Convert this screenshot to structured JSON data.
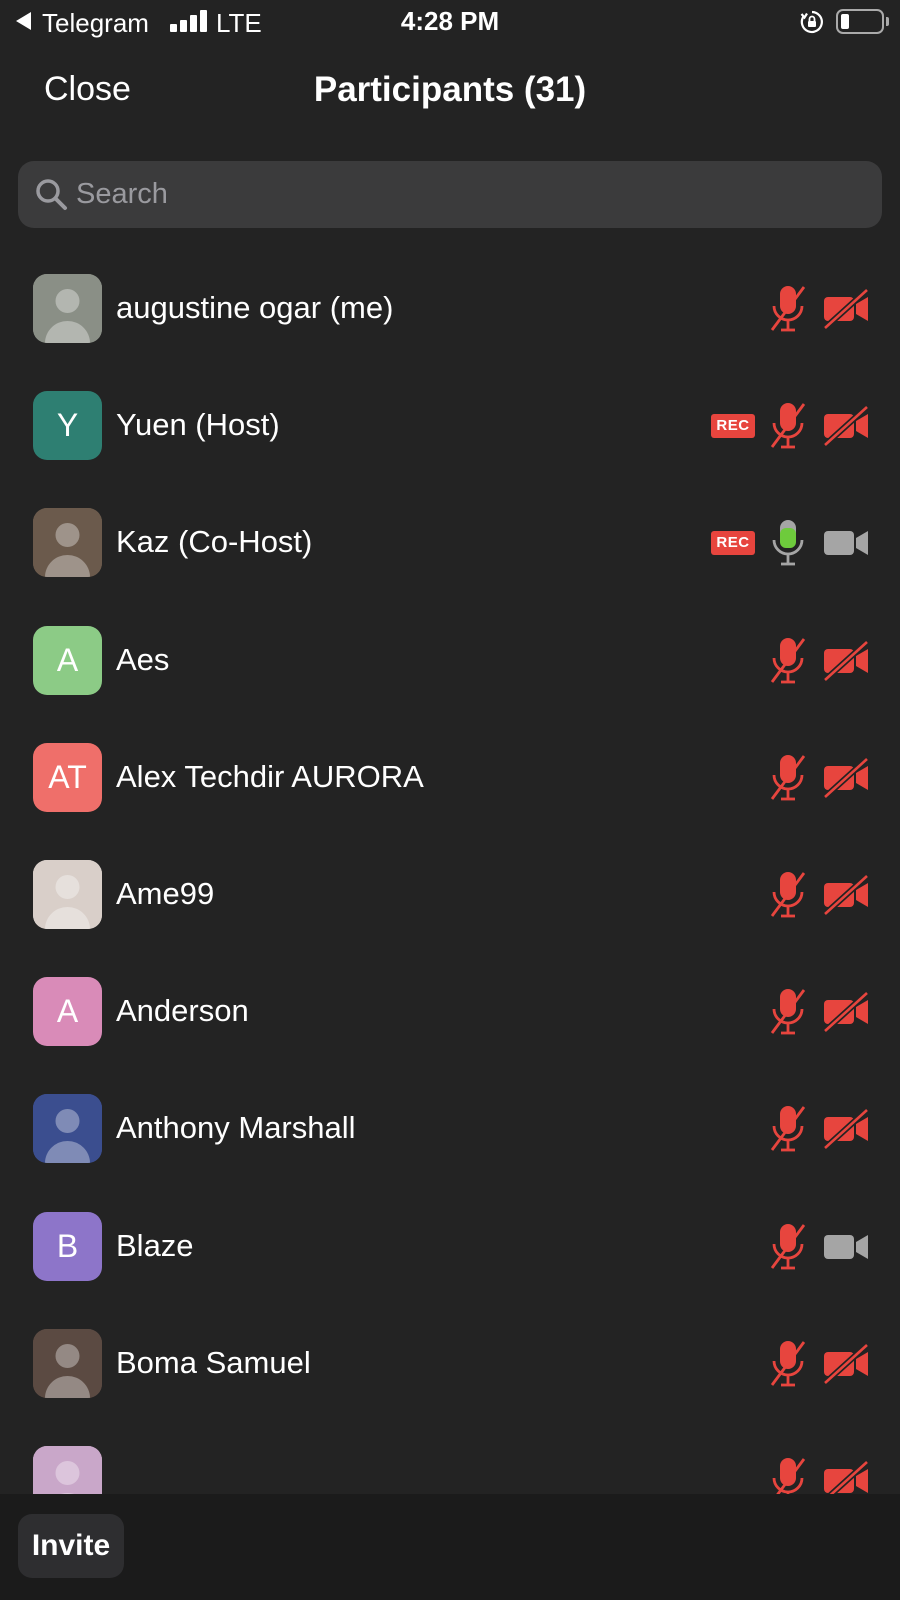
{
  "status_bar": {
    "app": "Telegram",
    "network": "LTE",
    "time": "4:28 PM",
    "icons": [
      "back-arrow-icon",
      "signal-icon",
      "rotation-lock-icon",
      "battery-icon"
    ]
  },
  "header": {
    "close_label": "Close",
    "title": "Participants (31)"
  },
  "search": {
    "placeholder": "Search",
    "value": ""
  },
  "participants": [
    {
      "name": "augustine ogar (me)",
      "avatar": "photo",
      "initials": "",
      "avatar_color": "#8a8f86",
      "rec": false,
      "mic": "muted",
      "video": "off"
    },
    {
      "name": "Yuen (Host)",
      "avatar": "initials",
      "initials": "Y",
      "avatar_color": "#2e7f72",
      "rec": true,
      "mic": "muted",
      "video": "off"
    },
    {
      "name": "Kaz (Co-Host)",
      "avatar": "photo",
      "initials": "",
      "avatar_color": "#6b5a4c",
      "rec": true,
      "mic": "on",
      "video": "on"
    },
    {
      "name": "Aes",
      "avatar": "initials",
      "initials": "A",
      "avatar_color": "#8ccb86",
      "rec": false,
      "mic": "muted",
      "video": "off"
    },
    {
      "name": "Alex Techdir AURORA",
      "avatar": "initials",
      "initials": "AT",
      "avatar_color": "#ef6f6a",
      "rec": false,
      "mic": "muted",
      "video": "off"
    },
    {
      "name": "Ame99",
      "avatar": "photo",
      "initials": "",
      "avatar_color": "#d9cfc9",
      "rec": false,
      "mic": "muted",
      "video": "off"
    },
    {
      "name": "Anderson",
      "avatar": "initials",
      "initials": "A",
      "avatar_color": "#d98bb8",
      "rec": false,
      "mic": "muted",
      "video": "off"
    },
    {
      "name": "Anthony Marshall",
      "avatar": "photo",
      "initials": "",
      "avatar_color": "#3b4e8f",
      "rec": false,
      "mic": "muted",
      "video": "off"
    },
    {
      "name": "Blaze",
      "avatar": "initials",
      "initials": "B",
      "avatar_color": "#8d75c9",
      "rec": false,
      "mic": "muted",
      "video": "on"
    },
    {
      "name": "Boma Samuel",
      "avatar": "photo",
      "initials": "",
      "avatar_color": "#5b4a42",
      "rec": false,
      "mic": "muted",
      "video": "off"
    },
    {
      "name": "",
      "avatar": "photo",
      "initials": "",
      "avatar_color": "#c9a7c9",
      "rec": false,
      "mic": "muted",
      "video": "off"
    }
  ],
  "rec_label": "REC",
  "bottom": {
    "invite_label": "Invite"
  },
  "colors": {
    "background": "#232323",
    "muted_red": "#e7453e",
    "active_green": "#6ecb3c",
    "inactive_gray": "#a5a5a5"
  }
}
